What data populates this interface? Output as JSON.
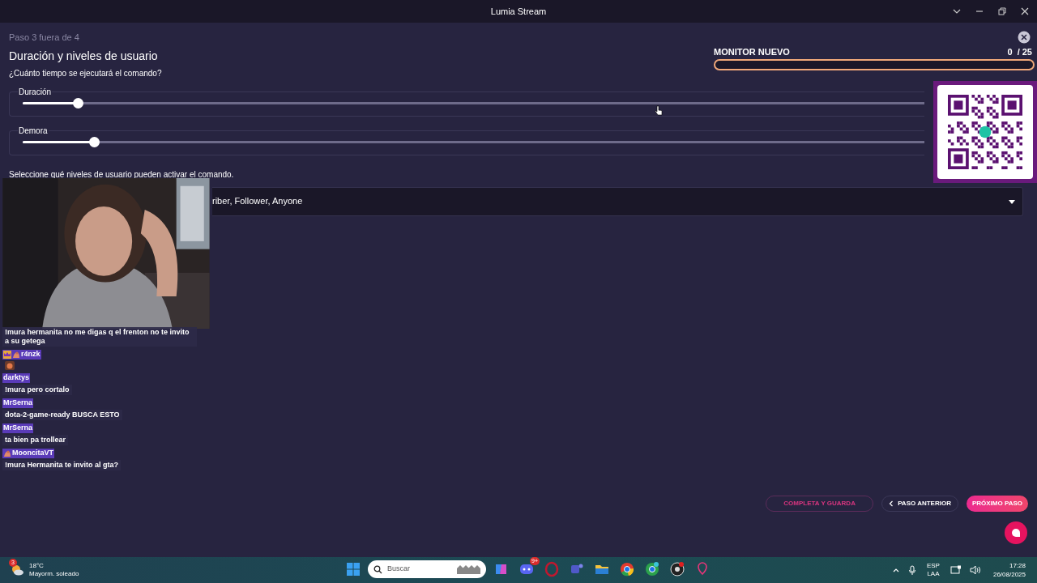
{
  "window": {
    "title": "Lumia Stream"
  },
  "step": "Paso 3 fuera de 4",
  "heading": "Duración y niveles de usuario",
  "question": "¿Cuánto tiempo se ejecutará el comando?",
  "monitor": {
    "label": "MONITOR NUEVO",
    "current": "0",
    "total": "/ 25",
    "level": 0
  },
  "sliders": [
    {
      "label": "Duración",
      "level": 0.061
    },
    {
      "label": "Demora",
      "level": 0.079
    }
  ],
  "levels_prompt": "Seleccione qué niveles de usuario pueden activar el comando.",
  "levels_select": {
    "value": "riber, Follower, Anyone"
  },
  "buttons": [
    {
      "label": "COMPLETA Y GUARDA",
      "kind": "outline"
    },
    {
      "label": "PASO ANTERIOR",
      "kind": "back"
    },
    {
      "label": "PRÓXIMO PASO",
      "kind": "primary"
    }
  ],
  "chat": [
    {
      "text": "!mura hermanita no me digas q el frenton no te invito a su getega"
    },
    {
      "user": "r4nzk",
      "badges": [
        {
          "kind": "crown"
        },
        {
          "kind": "emote"
        }
      ],
      "emote": true
    },
    {
      "user": "darktys",
      "text": "!mura pero cortalo"
    },
    {
      "user": "MrSerna",
      "text": "dota-2-game-ready BUSCA ESTO"
    },
    {
      "user": "MrSerna",
      "text": "ta bien pa trollear"
    },
    {
      "user": "MooncitaVT",
      "badges": [
        {
          "kind": "emote"
        }
      ],
      "text": "!mura Hermanita te invito al gta?"
    }
  ],
  "taskbar": {
    "weather": {
      "badge": "3",
      "temp": "18°C",
      "desc": "Mayorm. soleado"
    },
    "search_placeholder": "Buscar",
    "discord_badge": "9+",
    "lang": "ESP",
    "layout": "LAA",
    "time": "17:28",
    "date": "26/08/2025"
  }
}
